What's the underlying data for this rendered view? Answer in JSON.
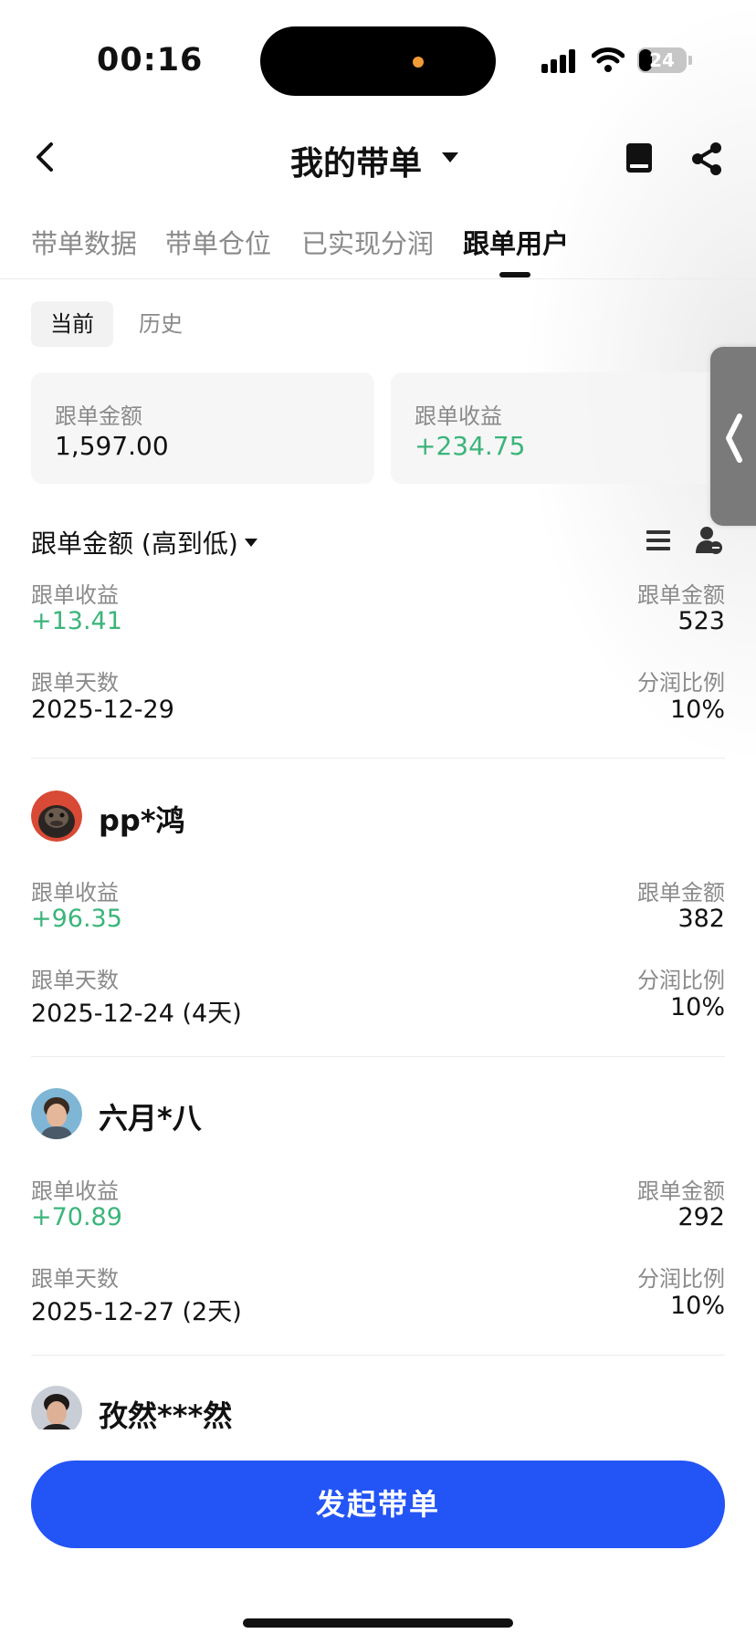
{
  "status_bar": {
    "time": "00:16",
    "battery": "24"
  },
  "header": {
    "title": "我的带单"
  },
  "tabs": [
    {
      "label": "带单数据"
    },
    {
      "label": "带单仓位"
    },
    {
      "label": "已实现分润"
    },
    {
      "label": "跟单用户",
      "active": true
    }
  ],
  "segment": {
    "current": "当前",
    "history": "历史"
  },
  "summary": {
    "amount_label": "跟单金额",
    "amount_value": "1,597.00",
    "profit_label": "跟单收益",
    "profit_value": "+234.75"
  },
  "sort": {
    "label": "跟单金额 (高到低)"
  },
  "labels": {
    "profit": "跟单收益",
    "amount": "跟单金额",
    "days": "跟单天数",
    "ratio": "分润比例"
  },
  "records": [
    {
      "profit": "+13.41",
      "amount": "523",
      "days": "2025-12-29",
      "ratio": "10%"
    },
    {
      "name": "pp*鸿",
      "profit": "+96.35",
      "amount": "382",
      "days": "2025-12-24 (4天)",
      "ratio": "10%"
    },
    {
      "name": "六月*八",
      "profit": "+70.89",
      "amount": "292",
      "days": "2025-12-27 (2天)",
      "ratio": "10%"
    },
    {
      "name": "孜然***然"
    }
  ],
  "cta": {
    "label": "发起带单"
  },
  "colors": {
    "accent": "#2354f5",
    "profit_green": "#3bb57a",
    "muted": "#8a8a8a"
  }
}
